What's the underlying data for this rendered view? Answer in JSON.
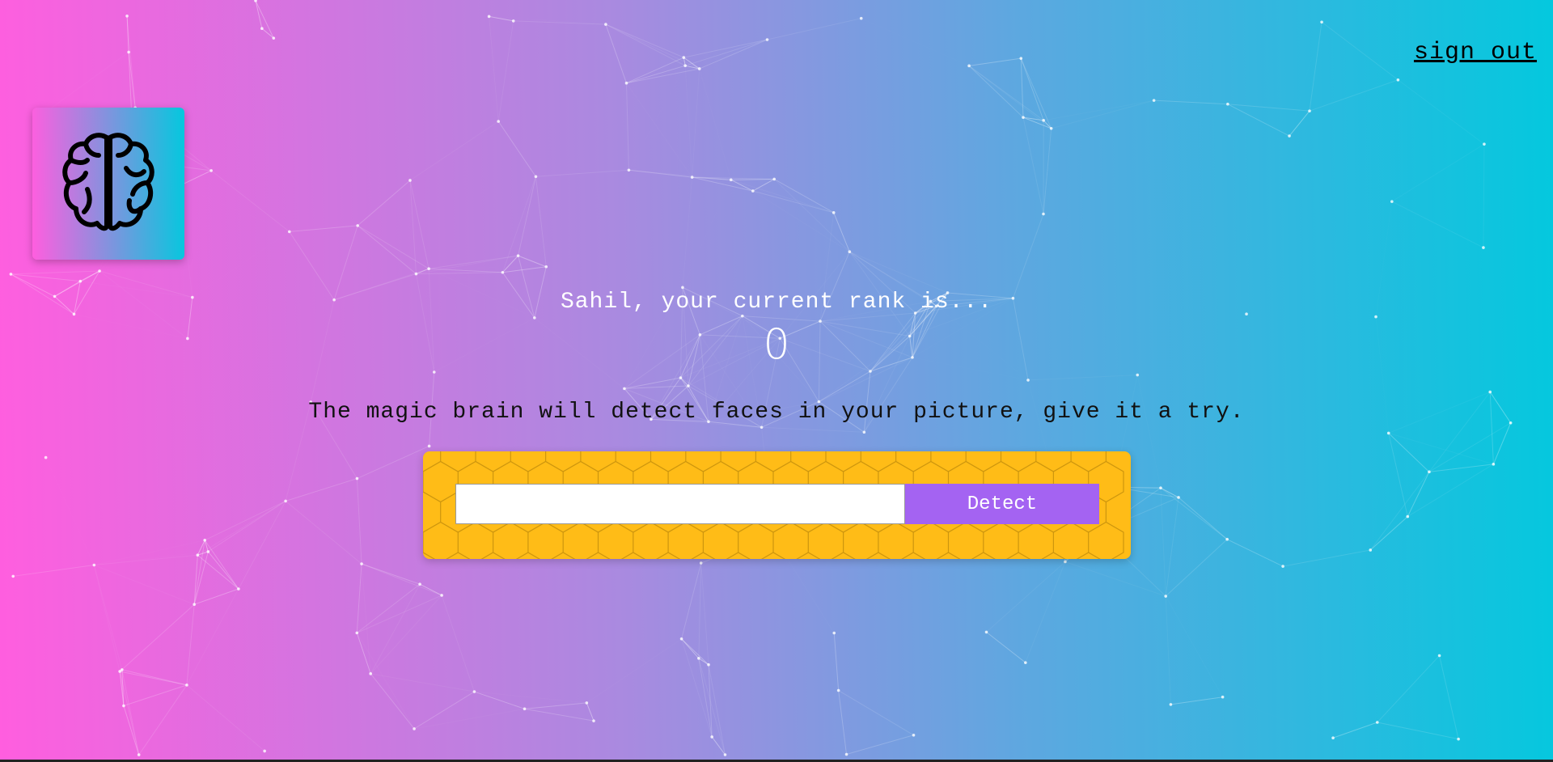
{
  "header": {
    "signout_label": "sign out"
  },
  "logo": {
    "icon": "brain-icon"
  },
  "rank": {
    "message": "Sahil, your current rank is...",
    "value": "0"
  },
  "intro": {
    "text": "The magic brain will detect faces in your picture, give it a try."
  },
  "form": {
    "input_value": "",
    "button_label": "Detect"
  },
  "colors": {
    "gradient_start": "#ff5edf",
    "gradient_end": "#04c8de",
    "panel": "#ffbc17",
    "button": "#a463f2"
  }
}
